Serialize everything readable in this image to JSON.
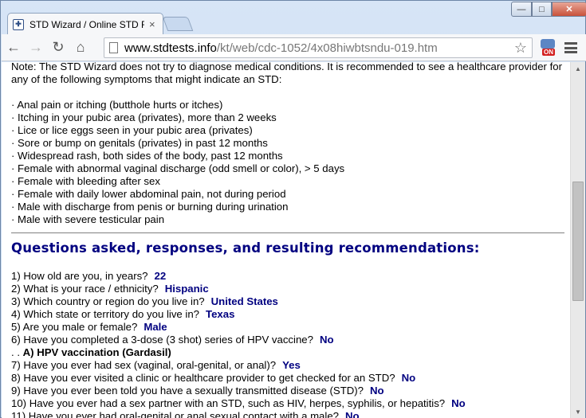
{
  "tab": {
    "title": "STD Wizard / Online STD F",
    "close": "×"
  },
  "window": {
    "minimize": "—",
    "maximize": "□",
    "close": "✕"
  },
  "toolbar": {
    "back": "←",
    "forward": "→",
    "reload": "↻",
    "home": "⌂",
    "url_host": "www.stdtests.info",
    "url_path": "/kt/web/cdc-1052/4x08hiwbtsndu-019.htm",
    "star": "☆",
    "extension_badge": "ON"
  },
  "content": {
    "note": "Note: The STD Wizard does not try to diagnose medical conditions. It is recommended to see a healthcare provider for any of the following symptoms that might indicate an STD:",
    "symptoms": [
      "· Anal pain or itching (butthole hurts or itches)",
      "· Itching in your pubic area (privates), more than 2 weeks",
      "· Lice or lice eggs seen in your pubic area (privates)",
      "· Sore or bump on genitals (privates) in past 12 months",
      "· Widespread rash, both sides of the body, past 12 months",
      "· Female with abnormal vaginal discharge (odd smell or color), > 5 days",
      "· Female with bleeding after sex",
      "· Female with daily lower abdominal pain, not during period",
      "· Male with discharge from penis or burning during urination",
      "· Male with severe testicular pain"
    ],
    "heading": "Questions asked, responses, and resulting recommendations:",
    "qa": [
      {
        "q": "1) How old are you, in years?",
        "a": "22"
      },
      {
        "q": "2) What is your race / ethnicity?",
        "a": "Hispanic"
      },
      {
        "q": "3) Which country or region do you live in?",
        "a": "United States"
      },
      {
        "q": "4) Which state or territory do you live in?",
        "a": "Texas"
      },
      {
        "q": "5) Are you male or female?",
        "a": "Male"
      },
      {
        "q": "6) Have you completed a 3-dose (3 shot) series of HPV vaccine?",
        "a": "No"
      },
      {
        "rec_prefix": ". . ",
        "rec": "A) HPV vaccination (Gardasil)"
      },
      {
        "q": "7) Have you ever had sex (vaginal, oral-genital, or anal)?",
        "a": "Yes"
      },
      {
        "q": "8) Have you ever visited a clinic or healthcare provider to get checked for an STD?",
        "a": "No"
      },
      {
        "q": "9) Have you ever been told you have a sexually transmitted disease (STD)?",
        "a": "No"
      },
      {
        "q": "10) Have you ever had a sex partner with an STD, such as HIV, herpes, syphilis, or hepatitis?",
        "a": "No"
      },
      {
        "q": "11) Have you ever had oral-genital or anal sexual contact with a male?",
        "a": "No"
      }
    ]
  },
  "scrollbar": {
    "up": "▲",
    "down": "▼"
  }
}
